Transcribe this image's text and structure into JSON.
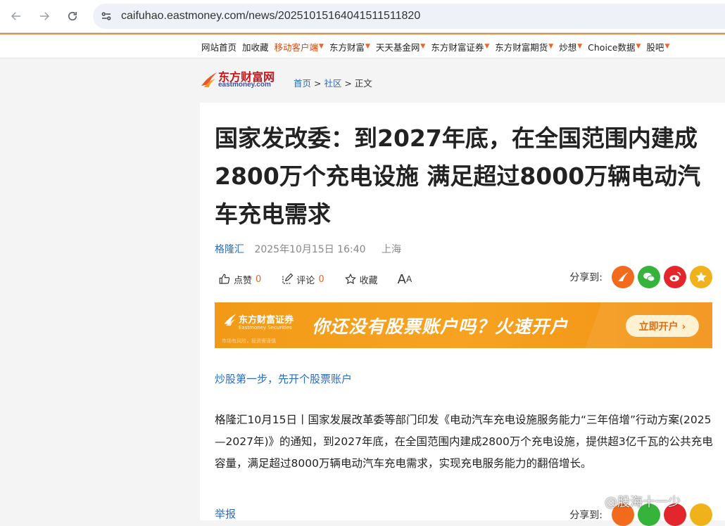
{
  "browser": {
    "url": "caifuhao.eastmoney.com/news/20251015164041511511820"
  },
  "topnav": {
    "items": [
      {
        "label": "网站首页",
        "caret": false,
        "highlight": false
      },
      {
        "label": "加收藏",
        "caret": false,
        "highlight": false
      },
      {
        "label": "移动客户端",
        "caret": true,
        "highlight": true
      },
      {
        "label": "东方财富",
        "caret": true,
        "highlight": false
      },
      {
        "label": "天天基金网",
        "caret": true,
        "highlight": false
      },
      {
        "label": "东方财富证券",
        "caret": true,
        "highlight": false
      },
      {
        "label": "东方财富期货",
        "caret": true,
        "highlight": false
      },
      {
        "label": "炒想",
        "caret": true,
        "highlight": false
      },
      {
        "label": "Choice数据",
        "caret": true,
        "highlight": false
      },
      {
        "label": "股吧",
        "caret": true,
        "highlight": false
      }
    ]
  },
  "site": {
    "logo_cn": "东方财富网",
    "logo_en": "eastmoney.com"
  },
  "breadcrumb": {
    "home": "首页",
    "sep1": " > ",
    "community": "社区",
    "sep2": " > ",
    "current": "正文"
  },
  "article": {
    "title": "国家发改委：到2027年底，在全国范围内建成2800万个充电设施 满足超过8000万辆电动汽车充电需求",
    "author": "格隆汇",
    "datetime": "2025年10月15日 16:40",
    "location": "上海",
    "body": "格隆汇10月15日丨国家发展改革委等部门印发《电动汽车充电设施服务能力“三年倍增”行动方案(2025—2027年)》的通知，到2027年底，在全国范围内建成2800万个充电设施，提供超3亿千瓦的公共充电容量，满足超过8000万辆电动汽车充电需求，实现充电服务能力的翻倍增长。",
    "promo_link": "炒股第一步，先开个股票账户",
    "report": "举报"
  },
  "actions": {
    "like_label": "点赞",
    "like_count": "0",
    "comment_label": "评论",
    "comment_count": "0",
    "favorite_label": "收藏",
    "fontsize_big": "A",
    "fontsize_small": "A",
    "share_label": "分享到:"
  },
  "banner": {
    "brand_cn": "东方财富证券",
    "brand_en": "Eastmoney Securities",
    "slogan": "你还没有股票账户吗？火速开户",
    "cta": "立即开户 ›",
    "tiny": "市场有风险，投资需谨慎"
  },
  "watermark": {
    "text": "@股海十一少"
  },
  "colors": {
    "accent_orange": "#f08a3a",
    "link_blue": "#2b6cbf",
    "banner_orange": "#f6a321"
  }
}
